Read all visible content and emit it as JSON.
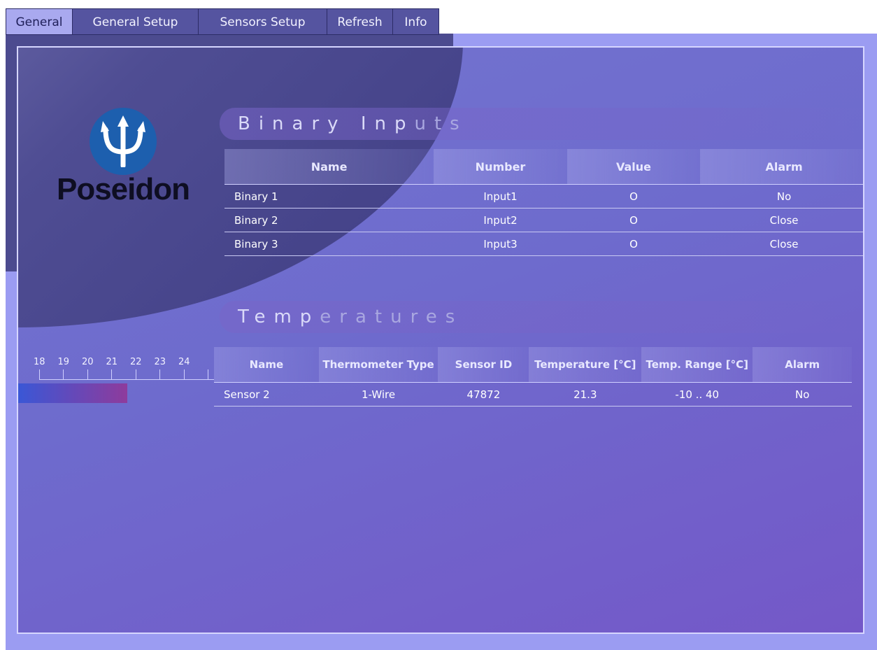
{
  "tabs": [
    {
      "label": "General",
      "active": true
    },
    {
      "label": "General Setup",
      "active": false
    },
    {
      "label": "Sensors Setup",
      "active": false
    },
    {
      "label": "Refresh",
      "active": false
    },
    {
      "label": "Info",
      "active": false
    }
  ],
  "brand": {
    "name": "Poseidon",
    "icon": "trident-icon",
    "color": "#1d5fae"
  },
  "binary_inputs": {
    "title_main": "Binary Inp",
    "title_dim": "uts",
    "headers": [
      "Name",
      "Number",
      "Value",
      "Alarm"
    ],
    "rows": [
      {
        "name": "Binary 1",
        "number": "Input1",
        "value": "O",
        "alarm": "No"
      },
      {
        "name": "Binary 2",
        "number": "Input2",
        "value": "O",
        "alarm": "Close"
      },
      {
        "name": "Binary 3",
        "number": "Input3",
        "value": "O",
        "alarm": "Close"
      }
    ]
  },
  "temperatures": {
    "title_main": "Temp",
    "title_dim": "eratures",
    "scale": [
      "18",
      "19",
      "20",
      "21",
      "22",
      "23",
      "24"
    ],
    "bar_value": 21.3,
    "headers": [
      "Name",
      "Thermometer Type",
      "Sensor ID",
      "Temperature [°C]",
      "Temp. Range [°C]",
      "Alarm"
    ],
    "rows": [
      {
        "name": "Sensor 2",
        "type": "1-Wire",
        "id": "47872",
        "temperature": "21.3",
        "range": "-10 .. 40",
        "alarm": "No"
      }
    ]
  }
}
